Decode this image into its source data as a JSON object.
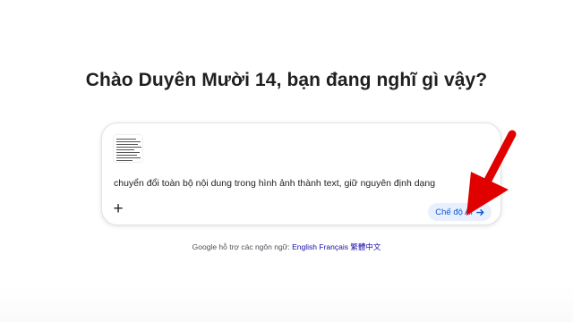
{
  "greeting": "Chào Duyên Mười 14, bạn đang nghĩ gì vậy?",
  "composer": {
    "prompt_text": "chuyển đổi toàn bộ nội dung trong hình ảnh thành text, giữ nguyên định dạng",
    "plus_label": "+",
    "ai_mode_label": "Chế độ AI",
    "attachment_icon": "image-thumbnail-icon"
  },
  "footer": {
    "prefix": "Google hỗ trợ các ngôn ngữ:",
    "languages": [
      "English",
      "Français",
      "繁體中文"
    ]
  },
  "colors": {
    "accent": "#0b57d0",
    "ai_button_bg": "#e8f0fe",
    "annotation_arrow": "#e00000"
  }
}
